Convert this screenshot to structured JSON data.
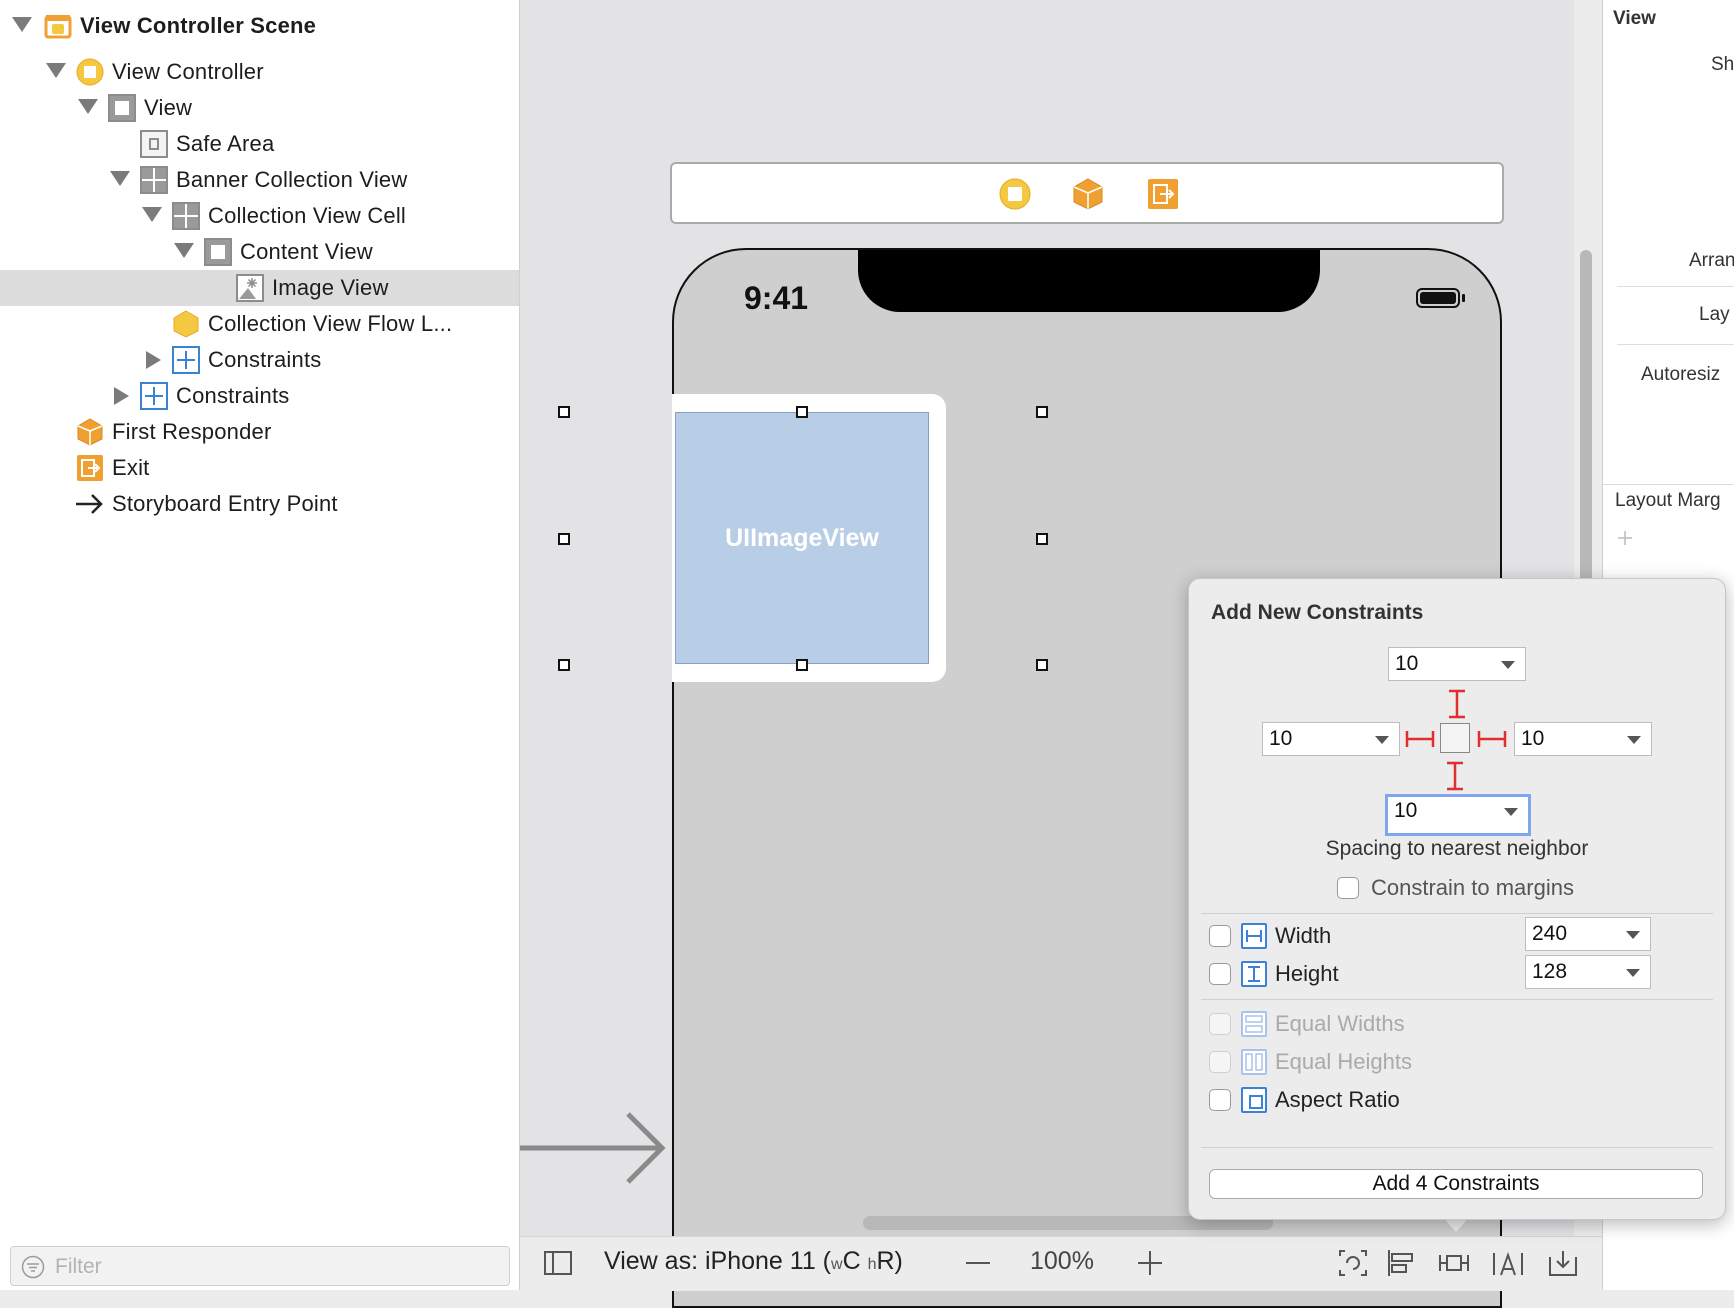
{
  "outline": {
    "items": [
      {
        "label": "View Controller Scene",
        "icon": "scene-icon",
        "expanded": true
      },
      {
        "label": "View Controller",
        "icon": "view-controller-icon",
        "expanded": true
      },
      {
        "label": "View",
        "icon": "view-icon",
        "expanded": true
      },
      {
        "label": "Safe Area",
        "icon": "safe-area-icon"
      },
      {
        "label": "Banner Collection View",
        "icon": "collection-view-icon",
        "expanded": true
      },
      {
        "label": "Collection View Cell",
        "icon": "collection-view-cell-icon",
        "expanded": true
      },
      {
        "label": "Content View",
        "icon": "view-icon",
        "expanded": true
      },
      {
        "label": "Image View",
        "icon": "image-view-icon",
        "selected": true
      },
      {
        "label": "Collection View Flow L...",
        "icon": "flow-layout-icon"
      },
      {
        "label": "Constraints",
        "icon": "constraints-icon",
        "expanded": false
      },
      {
        "label": "Constraints",
        "icon": "constraints-icon",
        "expanded": false
      },
      {
        "label": "First Responder",
        "icon": "first-responder-icon"
      },
      {
        "label": "Exit",
        "icon": "exit-icon"
      },
      {
        "label": "Storyboard Entry Point",
        "icon": "arrow-right-icon"
      }
    ],
    "filter_placeholder": "Filter"
  },
  "canvas": {
    "status_time": "9:41",
    "image_view_label": "UIImageView"
  },
  "bottombar": {
    "view_as": "View as: iPhone 11 (",
    "size_w": "w",
    "size_c": "C",
    "size_h": "h",
    "size_r": "R",
    "close_paren": ")",
    "zoom": "100%"
  },
  "inspector": {
    "title": "View",
    "show": "Sh",
    "arrange": "Arran",
    "layout": "Lay",
    "autoresize": "Autoresiz",
    "layout_margins": "Layout Marg"
  },
  "popover": {
    "title": "Add New Constraints",
    "top": "10",
    "left": "10",
    "right": "10",
    "bottom": "10",
    "spacing_caption": "Spacing to nearest neighbor",
    "constrain_margins": "Constrain to margins",
    "width_label": "Width",
    "width_value": "240",
    "height_label": "Height",
    "height_value": "128",
    "equal_widths": "Equal Widths",
    "equal_heights": "Equal Heights",
    "aspect_ratio": "Aspect Ratio",
    "add_button": "Add 4 Constraints"
  },
  "colors": {
    "accent": "#3b82d6",
    "constraint_red": "#e02f2f",
    "selection": "#dcdcdc",
    "image_view_fill": "#b8cde6",
    "orange_icon": "#f0a030"
  }
}
